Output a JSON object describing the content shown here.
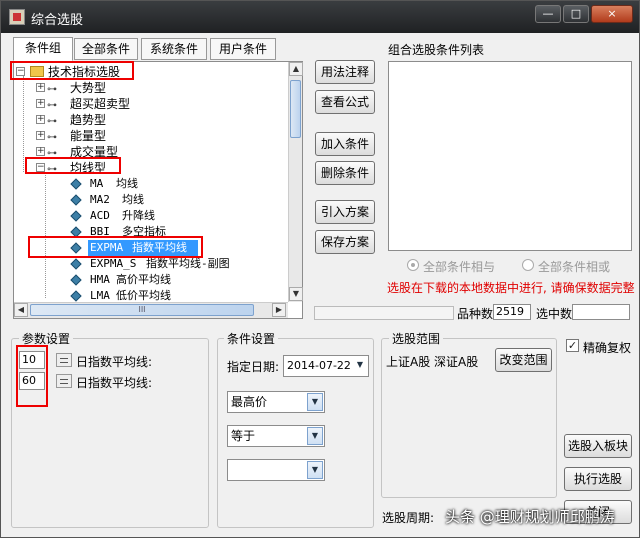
{
  "window": {
    "title": "综合选股"
  },
  "tabs": [
    "条件组",
    "全部条件",
    "系统条件",
    "用户条件"
  ],
  "tree": {
    "root": "技术指标选股",
    "categories": [
      "大势型",
      "超买超卖型",
      "趋势型",
      "能量型",
      "成交量型",
      "均线型"
    ],
    "indicators": [
      {
        "code": "MA",
        "name": "均线"
      },
      {
        "code": "MA2",
        "name": "均线"
      },
      {
        "code": "ACD",
        "name": "升降线"
      },
      {
        "code": "BBI",
        "name": "多空指标"
      },
      {
        "code": "EXPMA",
        "name": "指数平均线"
      },
      {
        "code": "EXPMA_S",
        "name": "指数平均线-副图"
      },
      {
        "code": "HMA",
        "name": "高价平均线"
      },
      {
        "code": "LMA",
        "name": "低价平均线"
      }
    ],
    "hscroll_label": "III"
  },
  "buttons": {
    "usage": "用法注释",
    "formula": "查看公式",
    "add_condition": "加入条件",
    "delete_condition": "删除条件",
    "import_plan": "引入方案",
    "save_plan": "保存方案",
    "change_range": "改变范围",
    "select_to_block": "选股入板块",
    "run": "执行选股",
    "close": "关闭"
  },
  "condition_list": {
    "title": "组合选股条件列表"
  },
  "logic": {
    "and_label": "全部条件相与",
    "or_label": "全部条件相或"
  },
  "notice": "选股在下载的本地数据中进行, 请确保数据完整",
  "stats": {
    "count_label": "品种数",
    "count_value": "2519",
    "selected_label": "选中数",
    "selected_value": ""
  },
  "params": {
    "title": "参数设置",
    "rows": [
      {
        "value": "10",
        "label": "日指数平均线:"
      },
      {
        "value": "60",
        "label": "日指数平均线:"
      }
    ]
  },
  "conditions": {
    "title": "条件设置",
    "date_label": "指定日期:",
    "date_value": "2014-07-22",
    "field": "最高价",
    "operator": "等于",
    "value": ""
  },
  "range": {
    "title": "选股范围",
    "text": "上证A股 深证A股"
  },
  "precise_rights": {
    "label": "精确复权",
    "checked": true
  },
  "period_label": "选股周期:",
  "watermark": "头条 @理财规划师邱鹏涛",
  "colors": {
    "highlight": "#e00000",
    "notice": "#e00000",
    "selection": "#3399ff"
  },
  "window_controls": {
    "minimize": "—",
    "maximize": "□",
    "close": "×"
  },
  "tree_icons": {
    "collapse": "−",
    "expand": "+",
    "key": "⊶"
  }
}
